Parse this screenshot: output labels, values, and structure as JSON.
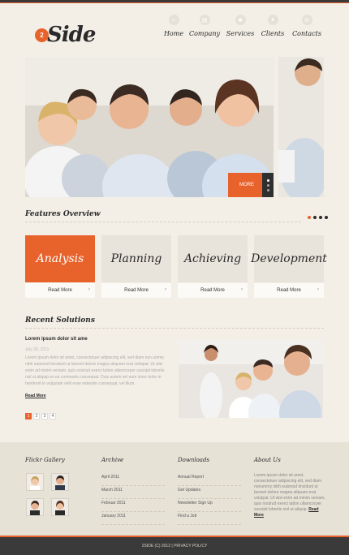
{
  "logo": {
    "badge": "2",
    "text": "Side"
  },
  "nav": [
    {
      "label": "Home",
      "icon": "home-icon"
    },
    {
      "label": "Company",
      "icon": "document-icon"
    },
    {
      "label": "Services",
      "icon": "gear-icon"
    },
    {
      "label": "Clients",
      "icon": "user-icon"
    },
    {
      "label": "Contacts",
      "icon": "phone-icon"
    }
  ],
  "slider": {
    "more_label": "MORE"
  },
  "features": {
    "title": "Features Overview",
    "items": [
      {
        "title": "Analysis",
        "read_more": "Read More"
      },
      {
        "title": "Planning",
        "read_more": "Read More"
      },
      {
        "title": "Achieving",
        "read_more": "Read More"
      },
      {
        "title": "Development",
        "read_more": "Read More"
      }
    ]
  },
  "recent": {
    "title": "Recent Solutions",
    "post_title": "Lorem ipsum dolor sit ame",
    "post_date": "July 28, 2011",
    "post_text": "Lorem ipsum dolor sit amet, consectetuer adipiscing elit, sed diam non ummy nibh euismod tincidunt ut laoreet dolore magna aliquam erat volutpat. Ut wisi enim ad minim veniam, quis nostrud exerci tation ullamcorper suscipit lobortis nisl ut aliquip ex ea commodo consequat. Duis autem vel eum iriure dolor in hendrerit in vulputate velit esse molestie consequat, vel illum.",
    "read_more": "Read More",
    "pages": [
      "1",
      "2",
      "3",
      "4"
    ]
  },
  "footer": {
    "flickr_title": "Flickr Gallery",
    "archive_title": "Archive",
    "archive": [
      "April 2011",
      "March 2011",
      "Februar 2011",
      "January 2011"
    ],
    "downloads_title": "Downloads",
    "downloads": [
      "Annual Report",
      "Get Updates",
      "Newsletter Sign Up",
      "Find a Job"
    ],
    "about_title": "About Us",
    "about_text": "Lorem ipsum dolor sit amet, consectetuer adipiscing elit, sed diam nonummy nibh euismod tincidunt ut laoreet dolore magna aliquam erat volutpat. Ut wisi enim ad minim veniam, quis nostrud exerci tation ullamcorper suscipit lobortis nisl ut aliquip.",
    "about_more": "Read More"
  },
  "copyright": "2SIDE (C) 2012 | PRIVACY POLICY"
}
